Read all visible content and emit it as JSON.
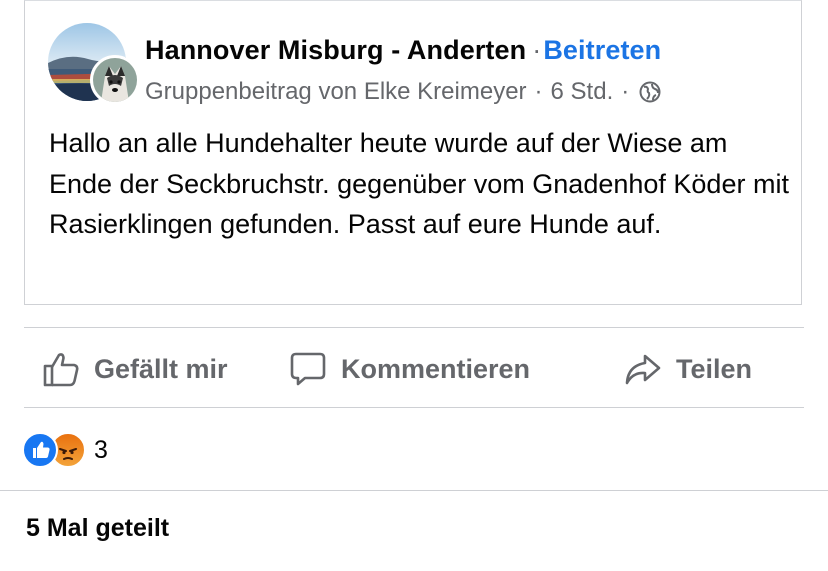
{
  "post": {
    "group_name": "Hannover Misburg - Anderten",
    "separator": "·",
    "join_label": "Beitreten",
    "subtitle_author": "Gruppenbeitrag von Elke Kreimeyer",
    "subtitle_dot": "·",
    "subtitle_time": "6 Std.",
    "subtitle_dot2": "·",
    "privacy_icon": "globe-icon",
    "body": "Hallo an alle Hundehalter heute wurde auf der Wiese am Ende der Seckbruchstr. gegenüber vom Gnadenhof Köder mit Rasierklingen gefunden. Passt auf eure Hunde auf."
  },
  "actions": {
    "like_label": "Gefällt mir",
    "comment_label": "Kommentieren",
    "share_label": "Teilen"
  },
  "reactions": {
    "types": [
      "like",
      "angry"
    ],
    "count": "3"
  },
  "shares": {
    "label": "5 Mal geteilt"
  },
  "colors": {
    "accent": "#1b74e4",
    "secondary_text": "#65676b",
    "like_blue": "#1877f2",
    "angry_orange": "#e9710f"
  }
}
